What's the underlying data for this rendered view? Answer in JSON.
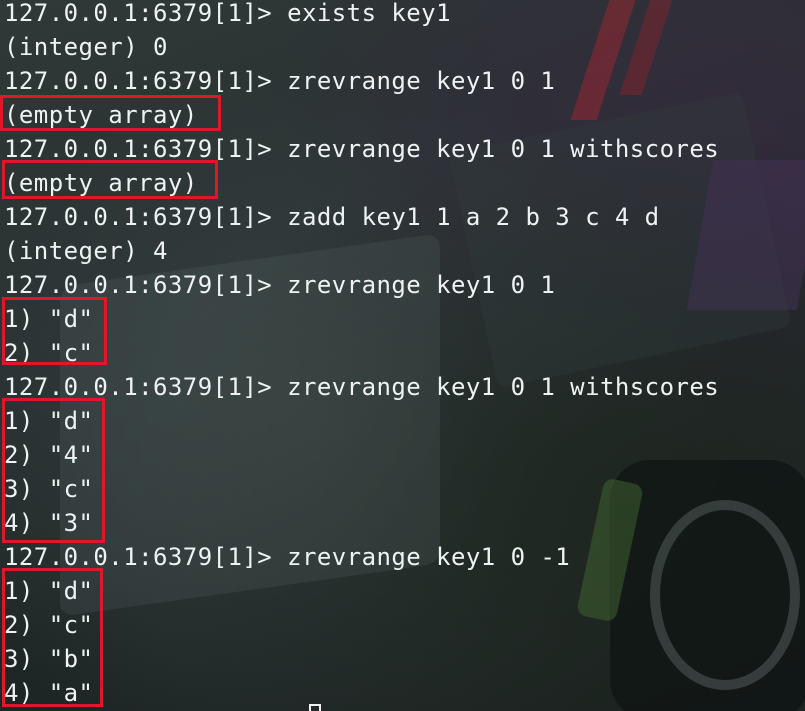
{
  "terminal": {
    "lines": [
      "127.0.0.1:6379[1]> exists key1",
      "(integer) 0",
      "127.0.0.1:6379[1]> zrevrange key1 0 1",
      "(empty array)",
      "127.0.0.1:6379[1]> zrevrange key1 0 1 withscores",
      "(empty array)",
      "127.0.0.1:6379[1]> zadd key1 1 a 2 b 3 c 4 d",
      "(integer) 4",
      "127.0.0.1:6379[1]> zrevrange key1 0 1",
      "1) \"d\"",
      "2) \"c\"",
      "127.0.0.1:6379[1]> zrevrange key1 0 1 withscores",
      "1) \"d\"",
      "2) \"4\"",
      "3) \"c\"",
      "4) \"3\"",
      "127.0.0.1:6379[1]> zrevrange key1 0 -1",
      "1) \"d\"",
      "2) \"c\"",
      "3) \"b\"",
      "4) \"a\""
    ]
  },
  "colors": {
    "text": "#eef2f2",
    "highlight": "#e0162b"
  }
}
